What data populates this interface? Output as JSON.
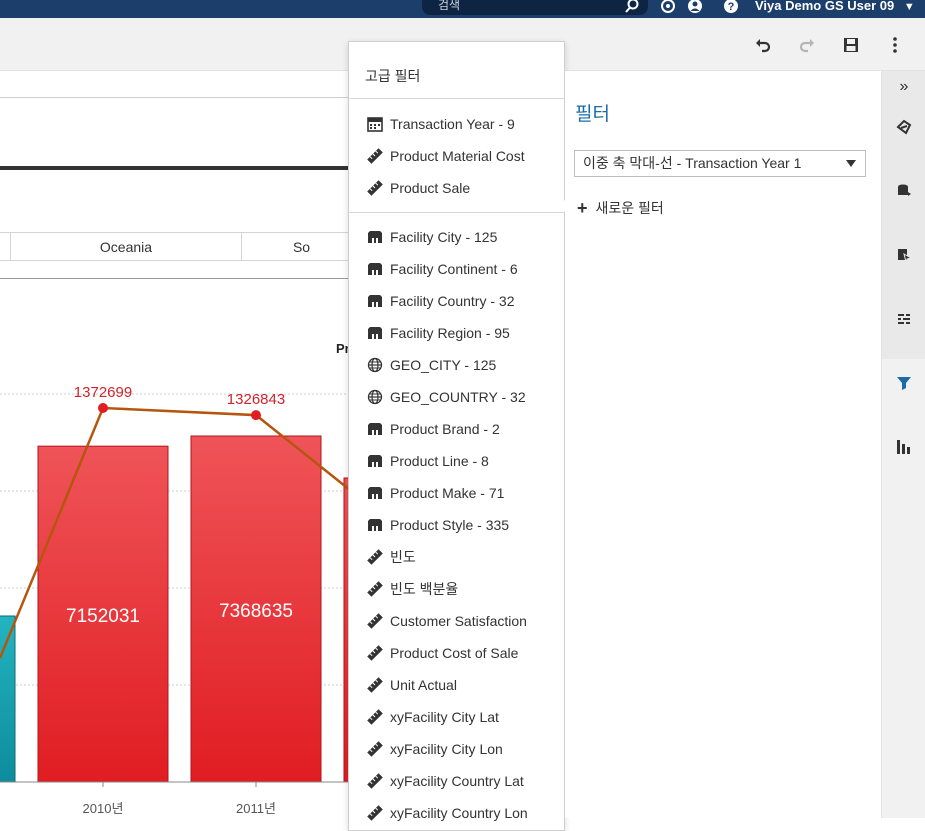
{
  "banner": {
    "search_placeholder": "검색",
    "user_name": "Viya Demo GS User 09",
    "user_caret": "▼"
  },
  "canvas": {
    "region_tabs": [
      "Oceania",
      "So"
    ],
    "partial_title": "Pr"
  },
  "chart_data": {
    "type": "bar",
    "categories": [
      "2010년",
      "2011년"
    ],
    "series": [
      {
        "values": [
          7152031,
          7368635
        ],
        "color": "#e32d33"
      },
      {
        "values": [
          1372699,
          1326843
        ],
        "color": "#b5560e"
      }
    ],
    "bar_labels": [
      "7152031",
      "7368635"
    ],
    "line_labels": [
      "1372699",
      "1326843"
    ]
  },
  "popup": {
    "title": "고급 필터",
    "group1": [
      {
        "label": "Transaction Year - 9",
        "icon": "calendar-icon"
      },
      {
        "label": "Product Material Cost",
        "icon": "measure-icon"
      },
      {
        "label": "Product Sale",
        "icon": "measure-icon"
      }
    ],
    "group2": [
      {
        "label": "Facility City - 125",
        "icon": "category-icon"
      },
      {
        "label": "Facility Continent - 6",
        "icon": "category-icon"
      },
      {
        "label": "Facility Country - 32",
        "icon": "category-icon"
      },
      {
        "label": "Facility Region - 95",
        "icon": "category-icon"
      },
      {
        "label": "GEO_CITY - 125",
        "icon": "globe-icon"
      },
      {
        "label": "GEO_COUNTRY - 32",
        "icon": "globe-icon"
      },
      {
        "label": "Product Brand - 2",
        "icon": "category-icon"
      },
      {
        "label": "Product Line - 8",
        "icon": "category-icon"
      },
      {
        "label": "Product Make - 71",
        "icon": "category-icon"
      },
      {
        "label": "Product Style - 335",
        "icon": "category-icon"
      },
      {
        "label": "빈도",
        "icon": "measure-icon"
      },
      {
        "label": "빈도 백분율",
        "icon": "measure-icon"
      },
      {
        "label": "Customer Satisfaction",
        "icon": "measure-icon"
      },
      {
        "label": "Product Cost of Sale",
        "icon": "measure-icon"
      },
      {
        "label": "Unit Actual",
        "icon": "measure-icon"
      },
      {
        "label": "xyFacility City Lat",
        "icon": "measure-icon"
      },
      {
        "label": "xyFacility City Lon",
        "icon": "measure-icon"
      },
      {
        "label": "xyFacility Country Lat",
        "icon": "measure-icon"
      },
      {
        "label": "xyFacility Country Lon",
        "icon": "measure-icon"
      }
    ]
  },
  "panel": {
    "title": "필터",
    "selected_filter": "이중 축 막대-선 - Transaction Year 1",
    "new_filter_label": "새로운 필터",
    "new_filter_plus": "+"
  },
  "rail": {
    "collapse_label": "»"
  }
}
